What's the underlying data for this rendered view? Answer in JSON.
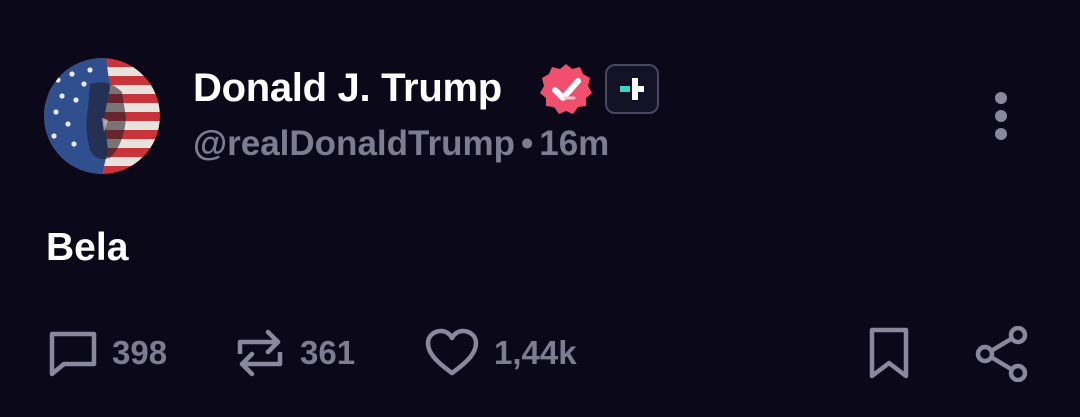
{
  "post": {
    "author": {
      "display_name": "Donald J. Trump",
      "handle": "@realDonaldTrump",
      "separator": "•",
      "time_ago": "16m",
      "verified_icon": "verified-badge-icon",
      "plus_icon": "plus-badge-icon"
    },
    "text": "Bela",
    "actions": {
      "reply_count": "398",
      "repost_count": "361",
      "like_count": "1,44k"
    },
    "icons": {
      "more": "more-vertical-icon",
      "reply": "comment-icon",
      "repost": "repost-icon",
      "like": "heart-icon",
      "bookmark": "bookmark-icon",
      "share": "share-icon"
    },
    "colors": {
      "background": "#0b0919",
      "text": "#ffffff",
      "muted": "#7e7c90",
      "verified": "#f0506e",
      "plus_accent": "#37d6c5"
    }
  }
}
